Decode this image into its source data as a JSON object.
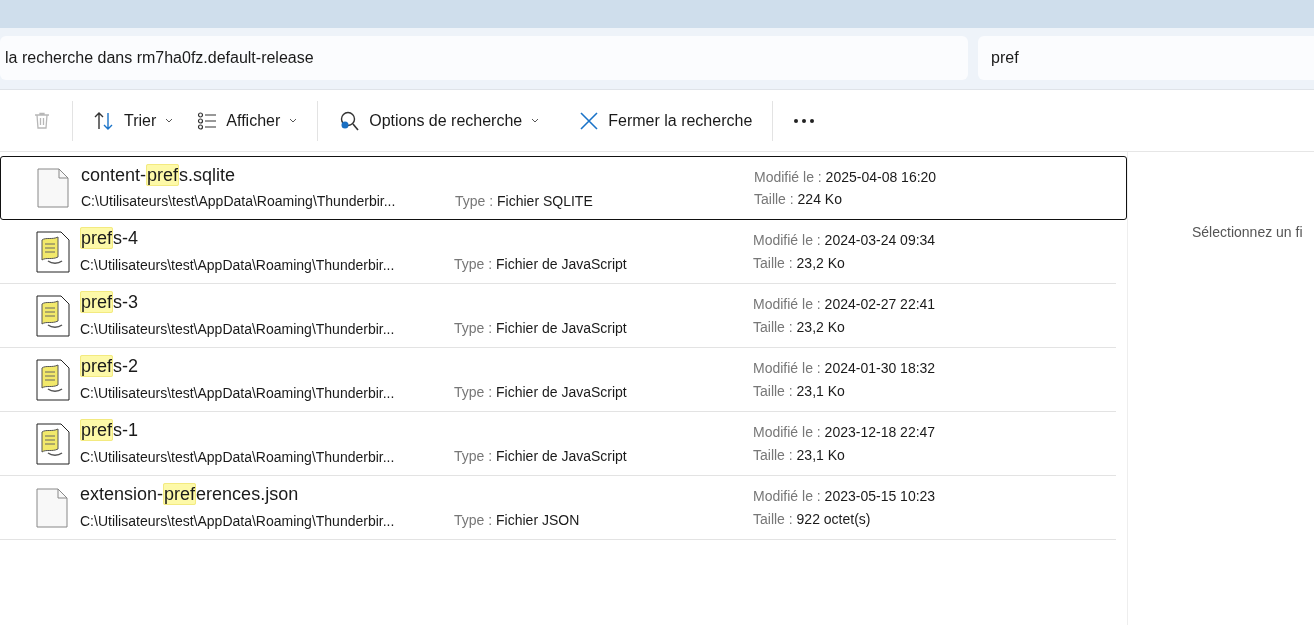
{
  "address_bar": {
    "text": "la recherche dans rm7ha0fz.default-release"
  },
  "search": {
    "value": "pref"
  },
  "toolbar": [
    {
      "kind": "delete",
      "disabled": true,
      "caret": false
    },
    {
      "kind": "sort",
      "label": "Trier",
      "disabled": false,
      "caret": true
    },
    {
      "kind": "view",
      "label": "Afficher",
      "disabled": false,
      "caret": true
    },
    {
      "kind": "options",
      "label": "Options de recherche",
      "disabled": false,
      "caret": true
    },
    {
      "kind": "close",
      "label": "Fermer la recherche",
      "disabled": false,
      "caret": false
    },
    {
      "kind": "more",
      "disabled": false,
      "caret": false
    }
  ],
  "files": [
    {
      "kind": "blank",
      "selected": true,
      "name": [
        {
          "text": "content-",
          "match": false
        },
        {
          "text": "pref",
          "match": true
        },
        {
          "text": "s.sqlite",
          "match": false
        }
      ],
      "path": "C:\\Utilisateurs\\test\\AppData\\Roaming\\Thunderbir...",
      "type_label": "Type :",
      "type": "Fichier SQLITE",
      "modified_label": "Modifié le :",
      "modified": "2025-04-08 16:20",
      "size_label": "Taille :",
      "size": "224 Ko"
    },
    {
      "kind": "script",
      "selected": false,
      "name": [
        {
          "text": "pref",
          "match": true
        },
        {
          "text": "s-4",
          "match": false
        }
      ],
      "path": "C:\\Utilisateurs\\test\\AppData\\Roaming\\Thunderbir...",
      "type_label": "Type :",
      "type": "Fichier de JavaScript",
      "modified_label": "Modifié le :",
      "modified": "2024-03-24 09:34",
      "size_label": "Taille :",
      "size": "23,2 Ko"
    },
    {
      "kind": "script",
      "selected": false,
      "name": [
        {
          "text": "pref",
          "match": true
        },
        {
          "text": "s-3",
          "match": false
        }
      ],
      "path": "C:\\Utilisateurs\\test\\AppData\\Roaming\\Thunderbir...",
      "type_label": "Type :",
      "type": "Fichier de JavaScript",
      "modified_label": "Modifié le :",
      "modified": "2024-02-27 22:41",
      "size_label": "Taille :",
      "size": "23,2 Ko"
    },
    {
      "kind": "script",
      "selected": false,
      "name": [
        {
          "text": "pref",
          "match": true
        },
        {
          "text": "s-2",
          "match": false
        }
      ],
      "path": "C:\\Utilisateurs\\test\\AppData\\Roaming\\Thunderbir...",
      "type_label": "Type :",
      "type": "Fichier de JavaScript",
      "modified_label": "Modifié le :",
      "modified": "2024-01-30 18:32",
      "size_label": "Taille :",
      "size": "23,1 Ko"
    },
    {
      "kind": "script",
      "selected": false,
      "name": [
        {
          "text": "pref",
          "match": true
        },
        {
          "text": "s-1",
          "match": false
        }
      ],
      "path": "C:\\Utilisateurs\\test\\AppData\\Roaming\\Thunderbir...",
      "type_label": "Type :",
      "type": "Fichier de JavaScript",
      "modified_label": "Modifié le :",
      "modified": "2023-12-18 22:47",
      "size_label": "Taille :",
      "size": "23,1 Ko"
    },
    {
      "kind": "blank",
      "selected": false,
      "name": [
        {
          "text": "extension-",
          "match": false
        },
        {
          "text": "pref",
          "match": true
        },
        {
          "text": "erences.json",
          "match": false
        }
      ],
      "path": "C:\\Utilisateurs\\test\\AppData\\Roaming\\Thunderbir...",
      "type_label": "Type :",
      "type": "Fichier JSON",
      "modified_label": "Modifié le :",
      "modified": "2023-05-15 10:23",
      "size_label": "Taille :",
      "size": "922 octet(s)"
    }
  ],
  "preview_pane": {
    "message": "Sélectionnez un fi"
  }
}
